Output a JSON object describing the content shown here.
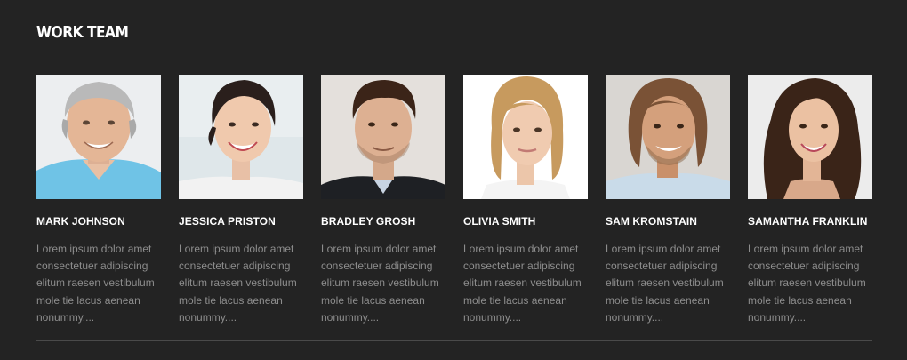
{
  "section": {
    "title": "WORK TEAM"
  },
  "members": [
    {
      "name": "MARK JOHNSON",
      "bio": "Lorem ipsum dolor amet consectetuer adipiscing elitum raesen vestibulum mole tie lacus aenean nonummy....",
      "photo_icon": "portrait-older-man-gray-hair"
    },
    {
      "name": "JESSICA PRISTON",
      "bio": "Lorem ipsum dolor amet consectetuer adipiscing elitum raesen vestibulum mole tie lacus aenean nonummy....",
      "photo_icon": "portrait-woman-dark-hair"
    },
    {
      "name": "BRADLEY GROSH",
      "bio": "Lorem ipsum dolor amet consectetuer adipiscing elitum raesen vestibulum mole tie lacus aenean nonummy....",
      "photo_icon": "portrait-man-brown-hair-suit"
    },
    {
      "name": "OLIVIA SMITH",
      "bio": "Lorem ipsum dolor amet consectetuer adipiscing elitum raesen vestibulum mole tie lacus aenean nonummy....",
      "photo_icon": "portrait-woman-blonde-hair"
    },
    {
      "name": "SAM KROMSTAIN",
      "bio": "Lorem ipsum dolor amet consectetuer adipiscing elitum raesen vestibulum mole tie lacus aenean nonummy....",
      "photo_icon": "portrait-man-long-brown-hair"
    },
    {
      "name": "SAMANTHA FRANKLIN",
      "bio": "Lorem ipsum dolor amet consectetuer adipiscing elitum raesen vestibulum mole tie lacus aenean nonummy....",
      "photo_icon": "portrait-woman-long-dark-hair"
    }
  ],
  "colors": {
    "background": "#232323",
    "heading": "#ffffff",
    "body_text": "#8d8d8d",
    "divider": "#4a4a4a"
  }
}
